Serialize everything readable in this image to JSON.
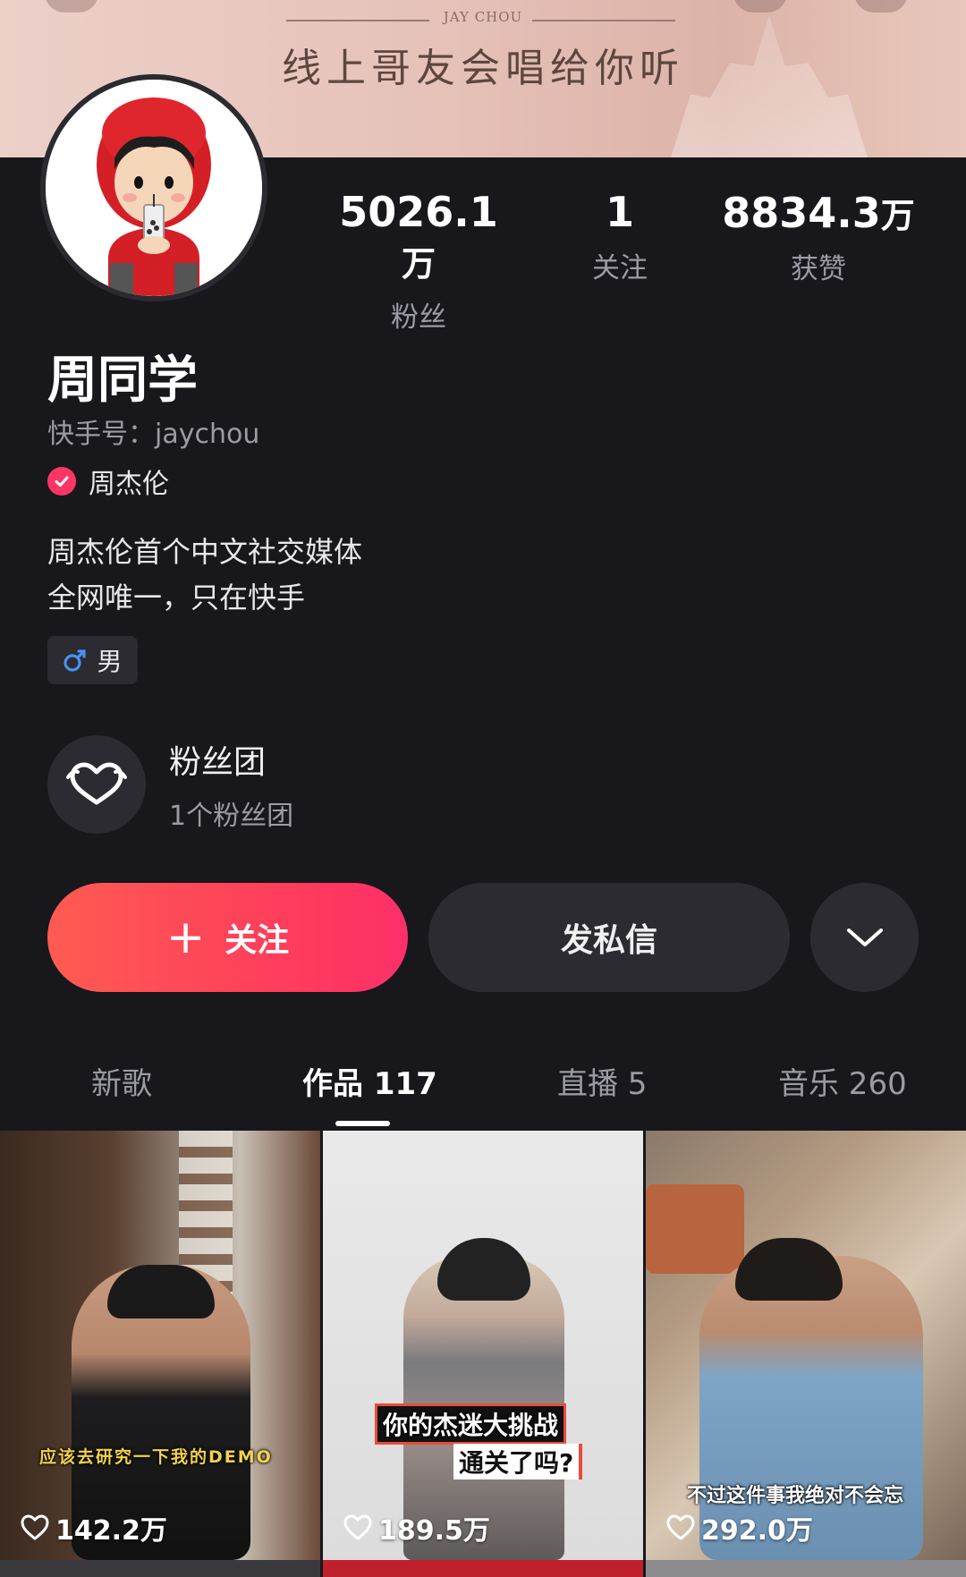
{
  "banner": {
    "brand": "JAY CHOU",
    "slogan": "线上哥友会唱给你听"
  },
  "stats": [
    {
      "value": "5026.1",
      "unit": "万",
      "label": "粉丝"
    },
    {
      "value": "1",
      "unit": "",
      "label": "关注"
    },
    {
      "value": "8834.3",
      "unit": "万",
      "label": "获赞"
    }
  ],
  "profile": {
    "name": "周同学",
    "kuaishou_id": "快手号：jaychou",
    "verified_name": "周杰伦",
    "bio_line1": "周杰伦首个中文社交媒体",
    "bio_line2": "全网唯一，只在快手",
    "gender": "男"
  },
  "fan_club": {
    "title": "粉丝团",
    "subtitle": "1个粉丝团"
  },
  "actions": {
    "follow": "关注",
    "message": "发私信"
  },
  "tabs": [
    {
      "label": "新歌"
    },
    {
      "label": "作品 117"
    },
    {
      "label": "直播 5"
    },
    {
      "label": "音乐 260"
    }
  ],
  "videos": [
    {
      "likes": "142.2万",
      "caption": "应该去研究一下我的DEMO"
    },
    {
      "likes": "189.5万",
      "caption_line1": "你的杰迷大挑战",
      "caption_line2": "通关了吗?"
    },
    {
      "likes": "292.0万",
      "caption": "不过这件事我绝对不会忘"
    }
  ],
  "colors": {
    "accent": "#fe3666",
    "background": "#17171c",
    "button": "#2b2b31"
  },
  "icons": [
    "verified-check-icon",
    "male-icon",
    "fan-club-heart-icon",
    "plus-icon",
    "chevron-down-icon",
    "heart-outline-icon"
  ]
}
